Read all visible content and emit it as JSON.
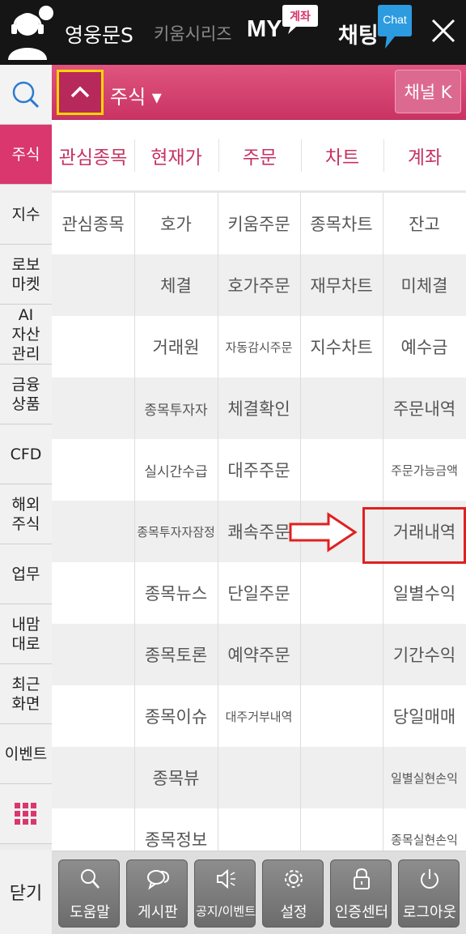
{
  "header": {
    "username": "영웅문S",
    "series_label": "키움시리즈",
    "my_label": "MY",
    "my_badge": "계좌",
    "chat_label": "채팅",
    "chat_badge": "Chat",
    "colors": {
      "background": "#151515",
      "accent": "#d9376e",
      "chat_badge": "#2d9be0"
    }
  },
  "sidebar": {
    "items": [
      {
        "label": "주식",
        "active": true
      },
      {
        "label": "지수"
      },
      {
        "label": "로보\n마켓"
      },
      {
        "label": "AI\n자산\n관리"
      },
      {
        "label": "금융\n상품"
      },
      {
        "label": "CFD"
      },
      {
        "label": "해외\n주식"
      },
      {
        "label": "업무"
      },
      {
        "label": "내맘\n대로"
      },
      {
        "label": "최근\n화면"
      },
      {
        "label": "이벤트"
      }
    ],
    "close_label": "닫기"
  },
  "menu_bar": {
    "title": "주식 ▾",
    "channel_button": "채널 K"
  },
  "category_tabs": [
    "관심종목",
    "현재가",
    "주문",
    "차트",
    "계좌"
  ],
  "grid_rows": [
    [
      "관심종목",
      "호가",
      "키움주문",
      "종목차트",
      "잔고"
    ],
    [
      "",
      "체결",
      "호가주문",
      "재무차트",
      "미체결"
    ],
    [
      "",
      "거래원",
      "자동감시주문",
      "지수차트",
      "예수금"
    ],
    [
      "",
      "종목투자자",
      "체결확인",
      "",
      "주문내역"
    ],
    [
      "",
      "실시간수급",
      "대주주문",
      "",
      "주문가능금액"
    ],
    [
      "",
      "종목투자자잠정",
      "쾌속주문",
      "",
      "거래내역"
    ],
    [
      "",
      "종목뉴스",
      "단일주문",
      "",
      "일별수익"
    ],
    [
      "",
      "종목토론",
      "예약주문",
      "",
      "기간수익"
    ],
    [
      "",
      "종목이슈",
      "대주거부내역",
      "",
      "당일매매"
    ],
    [
      "",
      "종목뷰",
      "",
      "",
      "일별실현손익"
    ],
    [
      "",
      "종목정보",
      "",
      "",
      "종목실현손익"
    ]
  ],
  "highlighted_item": "거래내역",
  "bottom_toolbar": [
    {
      "label": "도움말",
      "icon": "magnifier-icon"
    },
    {
      "label": "게시판",
      "icon": "chat-bubbles-icon"
    },
    {
      "label": "공지/이벤트",
      "icon": "speaker-icon"
    },
    {
      "label": "설정",
      "icon": "gear-icon"
    },
    {
      "label": "인증센터",
      "icon": "lock-icon"
    },
    {
      "label": "로그아웃",
      "icon": "power-icon"
    }
  ]
}
